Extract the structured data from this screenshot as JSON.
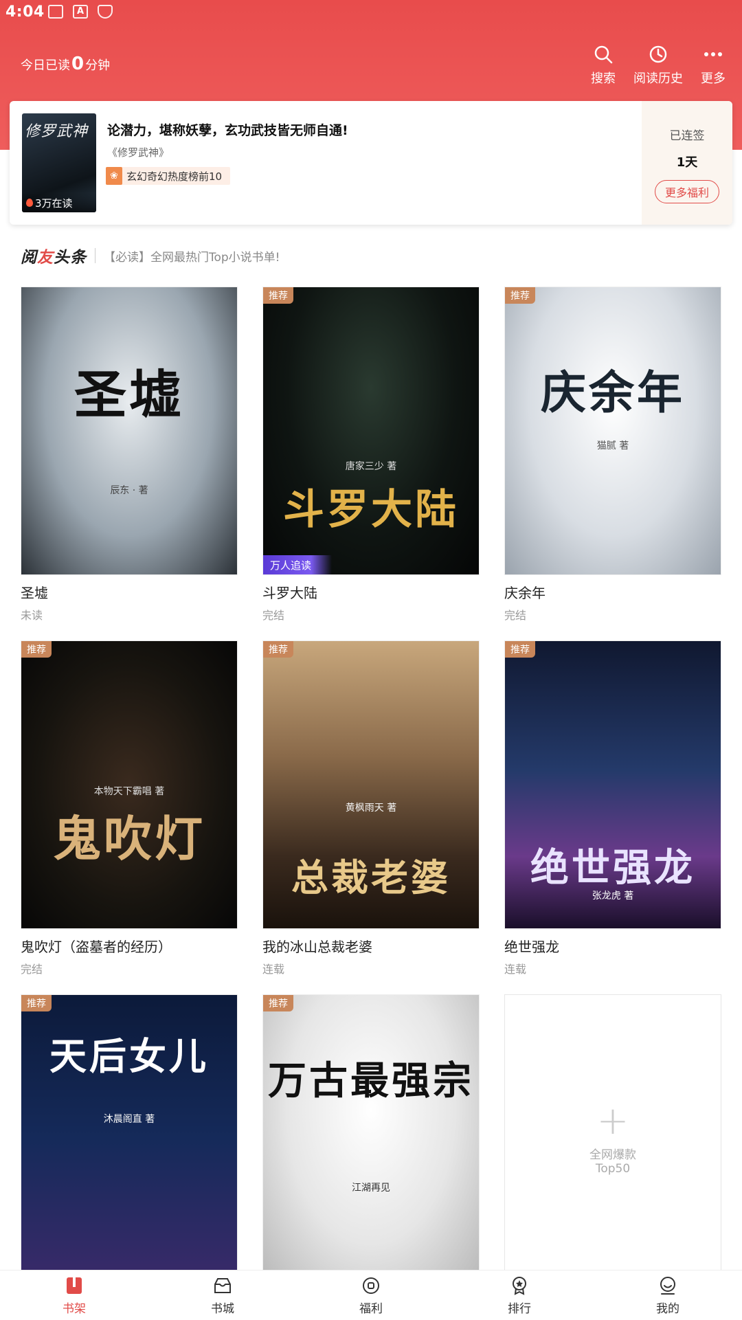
{
  "status_bar": {
    "time": "4:04",
    "icons": [
      "image-icon",
      "a-icon",
      "shield-icon"
    ]
  },
  "header": {
    "reading_prefix": "今日已读",
    "reading_minutes": "0",
    "reading_suffix": "分钟",
    "actions": [
      {
        "label": "搜索",
        "icon": "search-icon"
      },
      {
        "label": "阅读历史",
        "icon": "history-icon"
      },
      {
        "label": "更多",
        "icon": "more-icon"
      }
    ]
  },
  "promo": {
    "cover_title": "修罗武神",
    "reading_count": "3万在读",
    "headline": "论潜力，堪称妖孽，玄功武技皆无师自通!",
    "book_name": "《修罗武神》",
    "rank": "玄幻奇幻热度榜前10",
    "signin_label": "已连签",
    "signin_days": "1天",
    "more_button": "更多福利"
  },
  "headline_bar": {
    "logo_a": "阅",
    "logo_b": "友",
    "logo_c": "头条",
    "text": "【必读】全网最热门Top小说书单!"
  },
  "books": [
    {
      "title": "圣墟",
      "status": "未读",
      "cover_text": "圣墟",
      "author": "辰东 · 著",
      "tag": "",
      "badge": ""
    },
    {
      "title": "斗罗大陆",
      "status": "完结",
      "cover_text": "斗罗大陆",
      "author": "唐家三少 著",
      "tag": "推荐",
      "badge": "万人追读"
    },
    {
      "title": "庆余年",
      "status": "完结",
      "cover_text": "庆余年",
      "author": "猫腻 著",
      "tag": "推荐",
      "badge": ""
    },
    {
      "title": "鬼吹灯（盗墓者的经历）",
      "status": "完结",
      "cover_text": "鬼吹灯",
      "author": "本物天下霸唱 著",
      "tag": "推荐",
      "badge": ""
    },
    {
      "title": "我的冰山总裁老婆",
      "status": "连载",
      "cover_text": "总裁老婆",
      "author": "黄枫雨天 著",
      "tag": "推荐",
      "badge": ""
    },
    {
      "title": "绝世强龙",
      "status": "连载",
      "cover_text": "绝世强龙",
      "author": "张龙虎 著",
      "tag": "推荐",
      "badge": ""
    },
    {
      "title": "",
      "status": "",
      "cover_text": "天后女儿",
      "author": "沐晨阁直 著",
      "tag": "推荐",
      "badge": ""
    },
    {
      "title": "",
      "status": "",
      "cover_text": "万古最强宗",
      "author": "江湖再见",
      "tag": "推荐",
      "badge": ""
    }
  ],
  "add_card": {
    "line1": "全网爆款",
    "line2": "Top50"
  },
  "tabs": [
    {
      "label": "书架",
      "icon": "bookshelf-icon",
      "active": true
    },
    {
      "label": "书城",
      "icon": "bookstore-icon",
      "active": false
    },
    {
      "label": "福利",
      "icon": "welfare-icon",
      "active": false
    },
    {
      "label": "排行",
      "icon": "ranking-icon",
      "active": false
    },
    {
      "label": "我的",
      "icon": "profile-icon",
      "active": false
    }
  ],
  "colors": {
    "primary": "#e84c4c",
    "tag": "#c8865a",
    "promo_side_bg": "#fbf5ef"
  }
}
